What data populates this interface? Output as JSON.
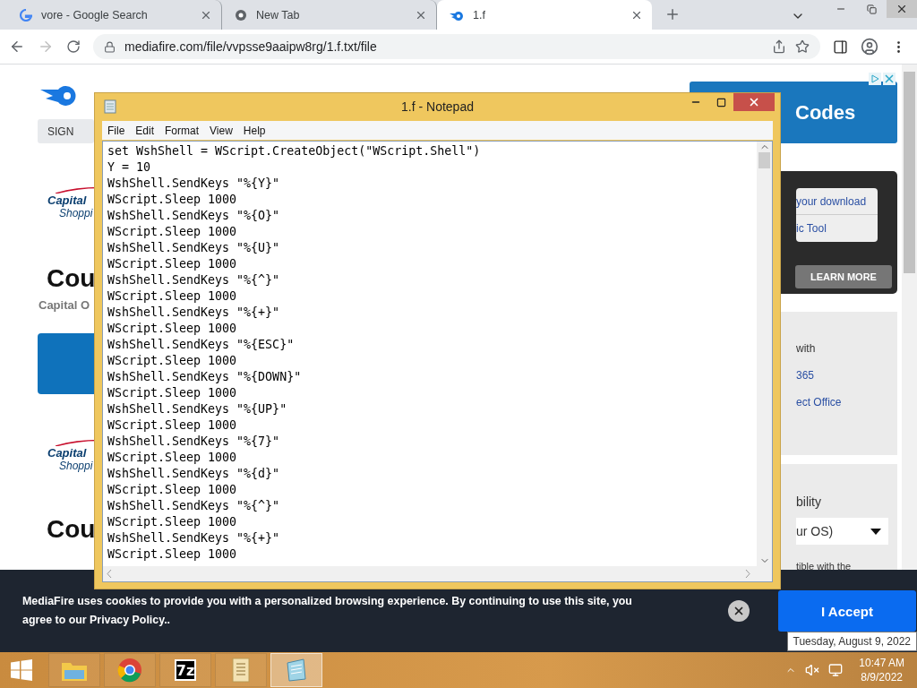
{
  "browser": {
    "tabs": [
      {
        "title": "vore - Google Search",
        "kind": "letter",
        "selected": false
      },
      {
        "title": "New Tab",
        "kind": "globe",
        "selected": false
      },
      {
        "title": "1.f",
        "kind": "flame",
        "selected": true
      }
    ],
    "forward_enabled": false,
    "address": "mediafire.com/file/vvpsse9aaipw8rg/1.f.txt/file"
  },
  "page": {
    "left": [
      {
        "kind": "sign",
        "text": "SIGN"
      },
      {
        "kind": "logo",
        "line1": "Capital",
        "line2": "Shoppi"
      },
      {
        "kind": "heading",
        "text": "Cou"
      },
      {
        "kind": "subtext",
        "text": "Capital O"
      },
      {
        "kind": "action"
      },
      {
        "kind": "logo",
        "line1": "Capital",
        "line2": "Shoppi"
      },
      {
        "kind": "heading",
        "text": "Cou"
      }
    ],
    "right": {
      "ad": "Codes",
      "download_card": {
        "links": [
          "your download",
          "ic Tool"
        ],
        "button": "LEARN MORE"
      },
      "office_card": [
        {
          "text": "with",
          "kind": "plain"
        },
        {
          "text": "365",
          "kind": "link"
        },
        {
          "text": "ect Office",
          "kind": "link"
        }
      ],
      "os_card": {
        "label": "bility",
        "select": "ur OS)",
        "note": "tible with the"
      }
    }
  },
  "notepad": {
    "title": "1.f - Notepad",
    "menu": [
      "File",
      "Edit",
      "Format",
      "View",
      "Help"
    ],
    "lines": [
      "set WshShell = WScript.CreateObject(\"WScript.Shell\")",
      "Y = 10",
      "WshShell.SendKeys \"%{Y}\"",
      "WScript.Sleep 1000",
      "WshShell.SendKeys \"%{O}\"",
      "WScript.Sleep 1000",
      "WshShell.SendKeys \"%{U}\"",
      "WScript.Sleep 1000",
      "WshShell.SendKeys \"%{^}\"",
      "WScript.Sleep 1000",
      "WshShell.SendKeys \"%{+}\"",
      "WScript.Sleep 1000",
      "WshShell.SendKeys \"%{ESC}\"",
      "WScript.Sleep 1000",
      "WshShell.SendKeys \"%{DOWN}\"",
      "WScript.Sleep 1000",
      "WshShell.SendKeys \"%{UP}\"",
      "WScript.Sleep 1000",
      "WshShell.SendKeys \"%{7}\"",
      "WScript.Sleep 1000",
      "WshShell.SendKeys \"%{d}\"",
      "WScript.Sleep 1000",
      "WshShell.SendKeys \"%{^}\"",
      "WScript.Sleep 1000",
      "WshShell.SendKeys \"%{+}\"",
      "WScript.Sleep 1000"
    ]
  },
  "cookie_banner": {
    "text": "MediaFire uses cookies to provide you with a personalized browsing experience. By continuing to use this site, you agree to our Privacy Policy..",
    "button": "I Accept"
  },
  "tooltip": "Tuesday, August 9, 2022",
  "taskbar": {
    "apps": [
      {
        "kind": "explorer",
        "selected": false
      },
      {
        "kind": "browser",
        "selected": false
      },
      {
        "kind": "archiver",
        "text": "7z",
        "selected": false
      },
      {
        "kind": "scroll",
        "selected": false
      },
      {
        "kind": "notepad",
        "selected": true
      }
    ],
    "time": "10:47 AM",
    "date": "8/9/2022"
  }
}
